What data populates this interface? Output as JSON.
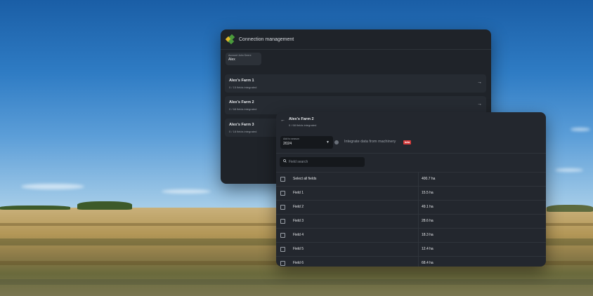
{
  "connection_panel": {
    "title": "Connection management",
    "account": {
      "label": "Account John Deere",
      "value": "Alex"
    },
    "farms": [
      {
        "name": "Alex's Farm 1",
        "sub": "0 / 15 fields integrated"
      },
      {
        "name": "Alex's Farm 2",
        "sub": "0 / 68 fields integrated"
      },
      {
        "name": "Alex's Farm 3",
        "sub": "0 / 18 fields integrated"
      }
    ]
  },
  "farm_panel": {
    "title": "Alex's Farm 2",
    "subtitle": "0 / 68 fields integrated",
    "season": {
      "label": "Add to season",
      "value": "2024"
    },
    "integrate_label": "Integrate data from machinery",
    "beta_label": "beta",
    "search_placeholder": "Field search",
    "rows": [
      {
        "name": "Select all fields",
        "area": "400.7 ha"
      },
      {
        "name": "Field 1",
        "area": "15.5 ha"
      },
      {
        "name": "Field 2",
        "area": "49.1 ha"
      },
      {
        "name": "Field 3",
        "area": "28.6 ha"
      },
      {
        "name": "Field 4",
        "area": "18.3 ha"
      },
      {
        "name": "Field 5",
        "area": "12.4 ha"
      },
      {
        "name": "Field 6",
        "area": "68.4 ha"
      }
    ]
  },
  "colors": {
    "panel_bg": "#1f2329",
    "beta_badge": "#d63a3a",
    "logo_yellow": "#e3b82a",
    "logo_green": "#4a9a3c"
  }
}
